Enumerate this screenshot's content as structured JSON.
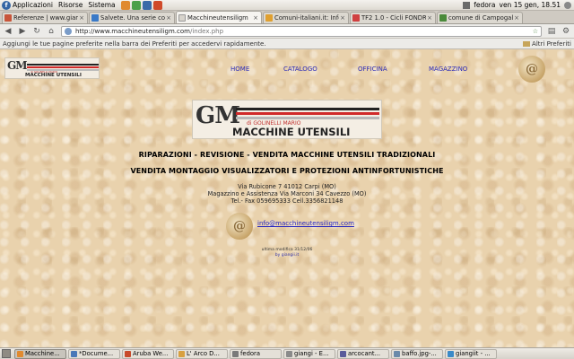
{
  "panel": {
    "menus": [
      "Applicazioni",
      "Risorse",
      "Sistema"
    ],
    "user": "fedora",
    "clock": "ven 15 gen, 18.51"
  },
  "tabs": [
    {
      "label": "Referenze | www.gian...",
      "color": "#c8553a"
    },
    {
      "label": "Salvete. Una serie co...",
      "color": "#3a7ac8"
    },
    {
      "label": "Macchineutensiligm",
      "color": "#d8d4cc"
    },
    {
      "label": "Comuni-italiani.it: Infor...",
      "color": "#e0a030"
    },
    {
      "label": "TF2 1.0 - Cicli FONDRI...",
      "color": "#d04040"
    },
    {
      "label": "comune di Campogall...",
      "color": "#4a8a3a"
    }
  ],
  "navbar": {
    "url_host": "http://www.macchineutensiligm.com",
    "url_path": "/index.php"
  },
  "bookmarks": {
    "hint": "Aggiungi le tue pagine preferite nella barra dei Preferiti per accedervi rapidamente.",
    "other": "Altri Preferiti"
  },
  "site": {
    "logo_small_top": "di GOLINELLI MARIO",
    "logo_small_name": "MACCHINE UTENSILI",
    "logo_big_sub": "di GOLINELLI MARIO",
    "logo_big_name": "MACCHINE UTENSILI",
    "nav": [
      "HOME",
      "CATALOGO",
      "OFFICINA",
      "MAGAZZINO"
    ],
    "headline1": "RIPARAZIONI - REVISIONE - VENDITA MACCHINE UTENSILI TRADIZIONALI",
    "headline2": "VENDITA MONTAGGIO VISUALIZZATORI E PROTEZIONI ANTINFORTUNISTICHE",
    "addr1": "Via Rubicone 7 41012 Carpi (MO)",
    "addr2": "Magazzino e Assistenza Via Marconi 34 Cavezzo (MO)",
    "addr3": "Tel.- Fax 059695333 Cell.3356821148",
    "email": "info@macchineutensiligm.com",
    "updated": "ultima modifica 31/12/06",
    "credit": "by giangii.it"
  },
  "taskbar": [
    {
      "label": "Macchine...",
      "color": "#e08a30",
      "active": true
    },
    {
      "label": "*Docume...",
      "color": "#4a78b8",
      "active": false
    },
    {
      "label": "Aruba We...",
      "color": "#c84a2a",
      "active": false
    },
    {
      "label": "L' Arco D...",
      "color": "#d8a040",
      "active": false
    },
    {
      "label": "fedora",
      "color": "#7a7a7a",
      "active": false
    },
    {
      "label": "giangi - E...",
      "color": "#8a8a8a",
      "active": false
    },
    {
      "label": "arcocant...",
      "color": "#5a5a9a",
      "active": false
    },
    {
      "label": "baffo.jpg-...",
      "color": "#6a8aaa",
      "active": false
    },
    {
      "label": "giangiit - ...",
      "color": "#3a8ac8",
      "active": false
    }
  ]
}
